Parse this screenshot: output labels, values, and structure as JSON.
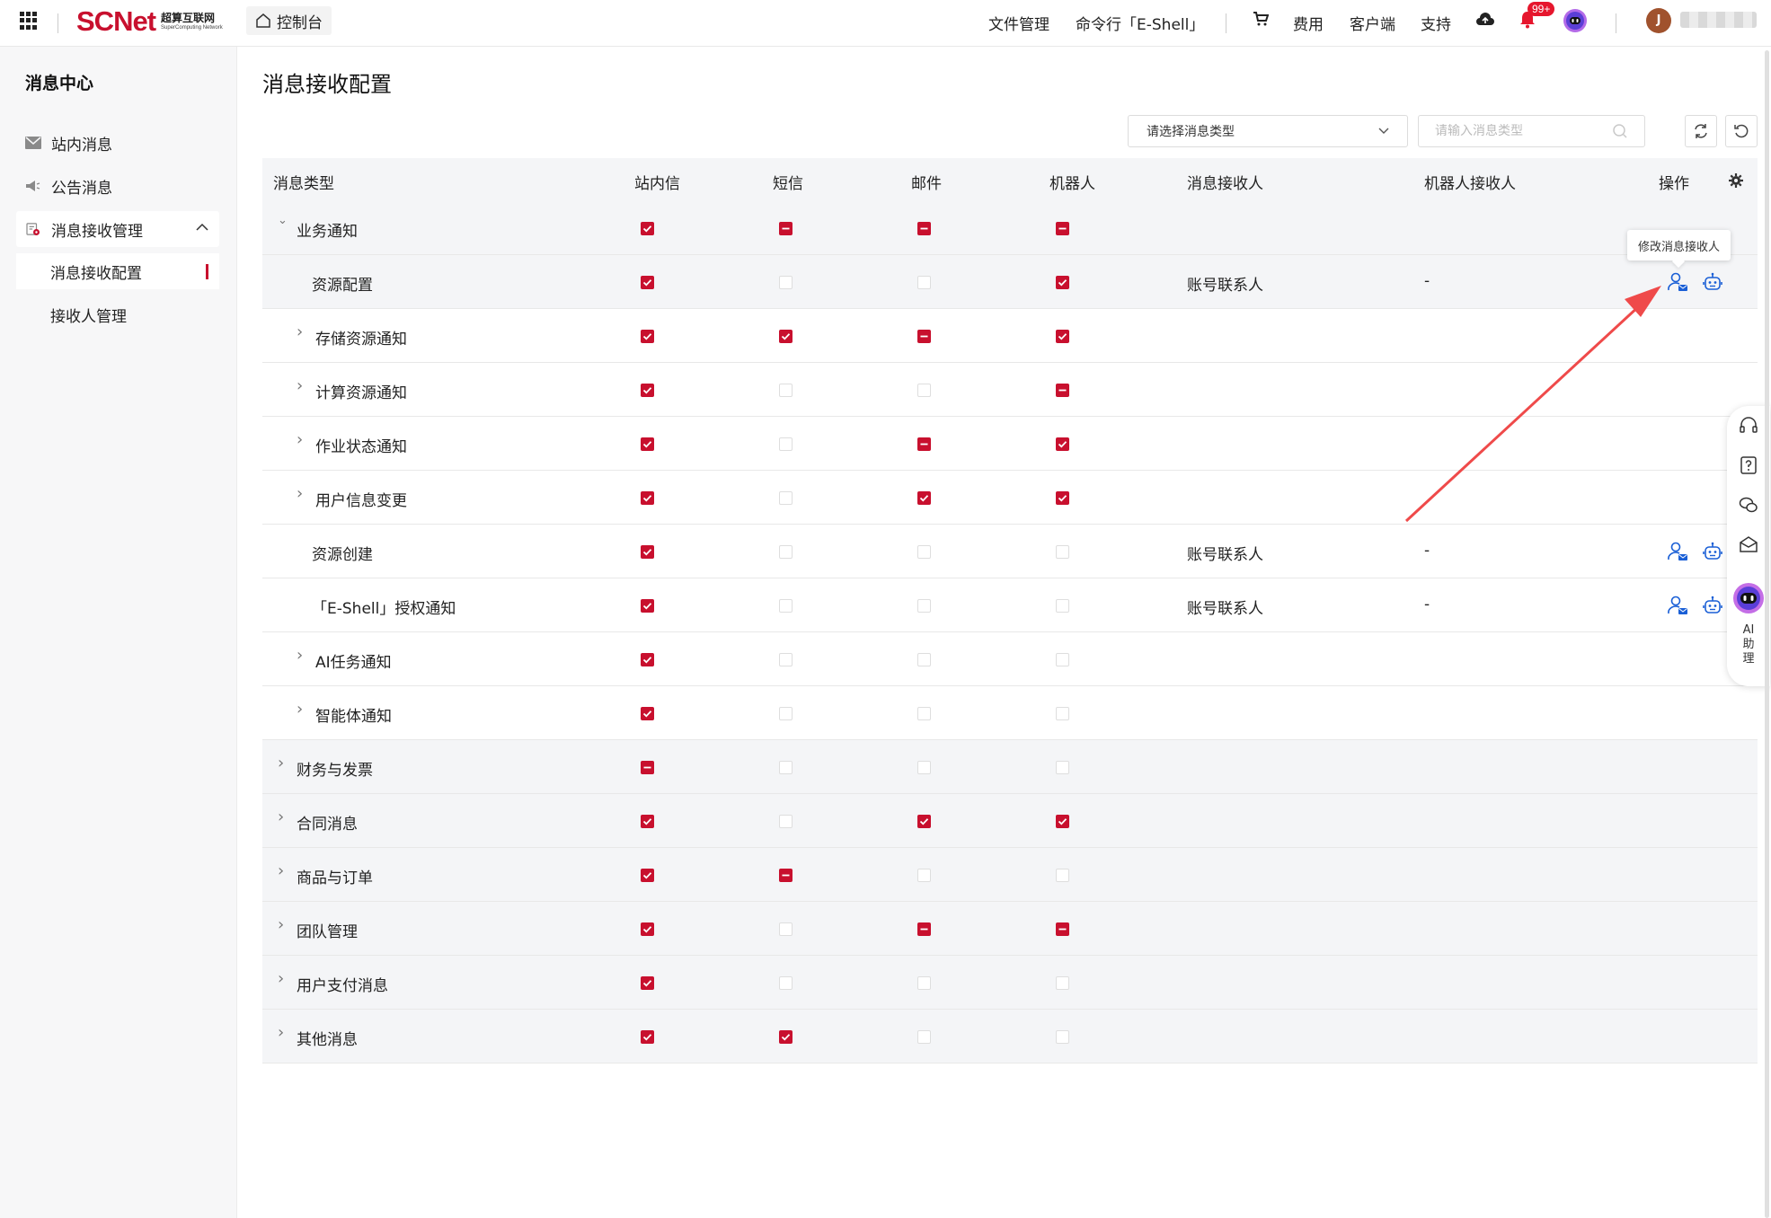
{
  "topbar": {
    "logo_text": "SCNet",
    "logo_cn": "超算互联网",
    "logo_en": "SuperComputing Network",
    "console_label": "控制台",
    "nav_files": "文件管理",
    "nav_eshell": "命令行「E-Shell」",
    "nav_fee": "费用",
    "nav_client": "客户端",
    "nav_support": "支持",
    "notification_badge": "99+",
    "avatar_initial": "J"
  },
  "sidebar": {
    "title": "消息中心",
    "items": [
      {
        "label": "站内消息",
        "icon": "mail-icon"
      },
      {
        "label": "公告消息",
        "icon": "speaker-icon"
      },
      {
        "label": "消息接收管理",
        "icon": "settings-doc-icon"
      }
    ],
    "sub_items": [
      {
        "label": "消息接收配置",
        "active": true
      },
      {
        "label": "接收人管理",
        "active": false
      }
    ]
  },
  "main": {
    "title": "消息接收配置",
    "select_placeholder": "请选择消息类型",
    "search_placeholder": "请输入消息类型",
    "columns": {
      "type": "消息类型",
      "site": "站内信",
      "sms": "短信",
      "email": "邮件",
      "robot": "机器人",
      "receiver": "消息接收人",
      "robot_receiver": "机器人接收人",
      "action": "操作"
    },
    "tooltip": "修改消息接收人",
    "rows": [
      {
        "label": "业务通知",
        "level": 0,
        "expand": "open",
        "site": "on",
        "sms": "part",
        "email": "part",
        "robot": "part",
        "receiver": "",
        "robot_receiver": "",
        "ops": false
      },
      {
        "label": "资源配置",
        "level": 1,
        "expand": "none",
        "site": "on",
        "sms": "off",
        "email": "off",
        "robot": "on",
        "receiver": "账号联系人",
        "robot_receiver": "-",
        "ops": true,
        "selected": true
      },
      {
        "label": "存储资源通知",
        "level": 1,
        "expand": "closed",
        "site": "on",
        "sms": "on",
        "email": "part",
        "robot": "on",
        "receiver": "",
        "robot_receiver": "",
        "ops": false
      },
      {
        "label": "计算资源通知",
        "level": 1,
        "expand": "closed",
        "site": "on",
        "sms": "off",
        "email": "off",
        "robot": "part",
        "receiver": "",
        "robot_receiver": "",
        "ops": false
      },
      {
        "label": "作业状态通知",
        "level": 1,
        "expand": "closed",
        "site": "on",
        "sms": "off",
        "email": "part",
        "robot": "on",
        "receiver": "",
        "robot_receiver": "",
        "ops": false
      },
      {
        "label": "用户信息变更",
        "level": 1,
        "expand": "closed",
        "site": "on",
        "sms": "off",
        "email": "on",
        "robot": "on",
        "receiver": "",
        "robot_receiver": "",
        "ops": false
      },
      {
        "label": "资源创建",
        "level": 1,
        "expand": "none",
        "site": "on",
        "sms": "off",
        "email": "off",
        "robot": "off",
        "receiver": "账号联系人",
        "robot_receiver": "-",
        "ops": true
      },
      {
        "label": "「E-Shell」授权通知",
        "level": 1,
        "expand": "none",
        "site": "on",
        "sms": "off",
        "email": "off",
        "robot": "off",
        "receiver": "账号联系人",
        "robot_receiver": "-",
        "ops": true
      },
      {
        "label": "AI任务通知",
        "level": 1,
        "expand": "closed",
        "site": "on",
        "sms": "off",
        "email": "off",
        "robot": "off",
        "receiver": "",
        "robot_receiver": "",
        "ops": false
      },
      {
        "label": "智能体通知",
        "level": 1,
        "expand": "closed",
        "site": "on",
        "sms": "off",
        "email": "off",
        "robot": "off",
        "receiver": "",
        "robot_receiver": "",
        "ops": false
      },
      {
        "label": "财务与发票",
        "level": 0,
        "expand": "closed",
        "site": "part",
        "sms": "off",
        "email": "off",
        "robot": "off",
        "receiver": "",
        "robot_receiver": "",
        "ops": false
      },
      {
        "label": "合同消息",
        "level": 0,
        "expand": "closed",
        "site": "on",
        "sms": "off",
        "email": "on",
        "robot": "on",
        "receiver": "",
        "robot_receiver": "",
        "ops": false
      },
      {
        "label": "商品与订单",
        "level": 0,
        "expand": "closed",
        "site": "on",
        "sms": "part",
        "email": "off",
        "robot": "off",
        "receiver": "",
        "robot_receiver": "",
        "ops": false
      },
      {
        "label": "团队管理",
        "level": 0,
        "expand": "closed",
        "site": "on",
        "sms": "off",
        "email": "part",
        "robot": "part",
        "receiver": "",
        "robot_receiver": "",
        "ops": false
      },
      {
        "label": "用户支付消息",
        "level": 0,
        "expand": "closed",
        "site": "on",
        "sms": "off",
        "email": "off",
        "robot": "off",
        "receiver": "",
        "robot_receiver": "",
        "ops": false
      },
      {
        "label": "其他消息",
        "level": 0,
        "expand": "closed",
        "site": "on",
        "sms": "on",
        "email": "off",
        "robot": "off",
        "receiver": "",
        "robot_receiver": "",
        "ops": false
      }
    ]
  },
  "float_panel": {
    "ai_label": "AI助理",
    "icons": [
      "headset-icon",
      "help-icon",
      "wechat-icon",
      "mail-open-icon",
      "ai-bot-icon"
    ]
  },
  "colors": {
    "brand": "#c8102e",
    "link_blue": "#1a5fd6",
    "annotation_arrow": "#ef4a4a"
  }
}
